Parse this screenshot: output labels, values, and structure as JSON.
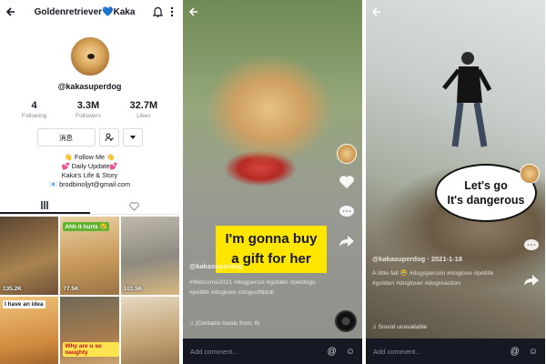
{
  "profile": {
    "title": "Goldenretriever💙Kaka",
    "handle": "@kakasuperdog",
    "stats": [
      {
        "value": "4",
        "label": "Following"
      },
      {
        "value": "3.3M",
        "label": "Followers"
      },
      {
        "value": "32.7M",
        "label": "Likes"
      }
    ],
    "message_button": "消息",
    "bio": [
      "👋 Follow Me 👋",
      "💕 Daily Update💕",
      "Kaka's Life & Story",
      "📧 brodbinoljyt@gmail.com"
    ],
    "grid": [
      {
        "views": "135.2K",
        "caption": "",
        "tint": "#7b5a3b"
      },
      {
        "views": "77.5K",
        "caption": "Ahh it hurts 😢",
        "tint": "#c99a5b"
      },
      {
        "views": "101.5K",
        "caption": "",
        "tint": "#8e8a80"
      },
      {
        "views": "",
        "caption": "I have an idea",
        "tint": "#d18a3f"
      },
      {
        "views": "",
        "caption": "Why are u so naughty",
        "tint": "#a87b4c"
      },
      {
        "views": "",
        "caption": "",
        "tint": "#c2a172"
      }
    ]
  },
  "video1": {
    "caption_lines": [
      "I'm gonna buy",
      "a gift for her"
    ],
    "username": "@kakasuperdog",
    "tags": "#Welcome2021 #dogpersol #golden #petdogs #petlife #doglove #dogsoftiktok",
    "music": "♫ (Contains music from: th",
    "comment_placeholder": "Add comment..."
  },
  "video2": {
    "bubble": [
      "Let's go",
      "It's dangerous"
    ],
    "username": "@kakasuperdog · 2021-1-18",
    "tags": "A little fall 😂 #dogsperson #doglove #petlife #golden #doglover #dogreaction",
    "music": "♫ Sound unavailable",
    "comment_placeholder": "Add comment..."
  }
}
